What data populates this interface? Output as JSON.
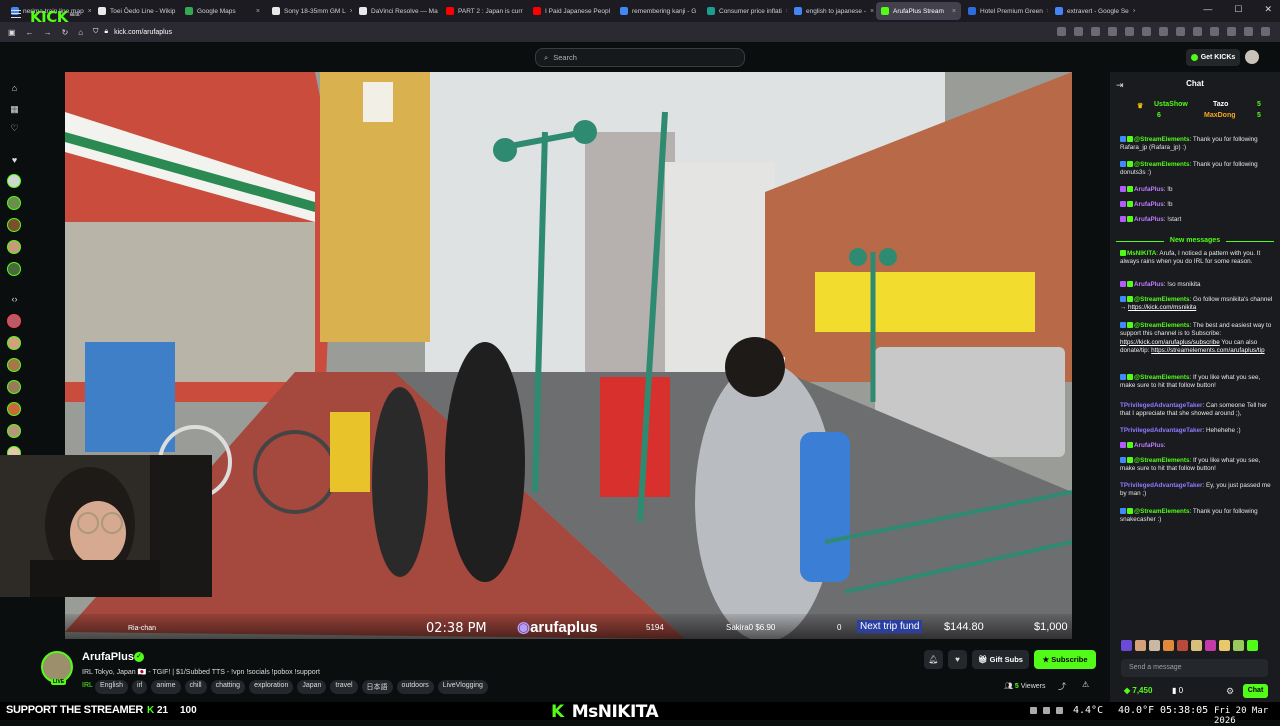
{
  "browser": {
    "tabs": [
      {
        "label": "nerima train line map",
        "color": "#4285f4"
      },
      {
        "label": "Toei Ōedo Line - Wikip",
        "color": "#e8e8e8"
      },
      {
        "label": "Google Maps",
        "color": "#34a853"
      },
      {
        "label": "Sony 18-35mm GM L",
        "color": "#e8e8e8"
      },
      {
        "label": "DaVinci Resolve — Ma",
        "color": "#e8e8e8"
      },
      {
        "label": "PART 2 : Japan is curr",
        "color": "#ff0000"
      },
      {
        "label": "I Paid Japanese Peopl",
        "color": "#ff0000"
      },
      {
        "label": "remembering kanji - G",
        "color": "#4285f4"
      },
      {
        "label": "Consumer price inflati",
        "color": "#1a9e8f"
      },
      {
        "label": "english to japanese -",
        "color": "#4285f4"
      },
      {
        "label": "ArufaPlus Stream",
        "color": "#53fc18",
        "active": true
      },
      {
        "label": "Hotel Premium Green",
        "color": "#2d6cdf"
      },
      {
        "label": "extravert - Google Se",
        "color": "#4285f4"
      }
    ],
    "url": "kick.com/arufaplus"
  },
  "kick": {
    "logo": "KICK",
    "logo_sup": "BETA",
    "search_placeholder": "Search",
    "get_kicks": "Get KICKs"
  },
  "overlay": {
    "time": "02:38 PM",
    "channel": "arufaplus",
    "count1": "5194",
    "sakira": "Sakira0 $6.90",
    "zero": "0",
    "trip": "Next trip fund",
    "amount": "$144.80",
    "goal": "$1,000",
    "ria": "Ria-chan"
  },
  "chat": {
    "title": "Chat",
    "gifters": [
      {
        "name": "UstaShow",
        "count": "6"
      },
      {
        "name": "Tazo",
        "count": "5"
      },
      {
        "name": "MaxDong",
        "count": "5"
      }
    ],
    "messages": [
      {
        "user": "@StreamElements",
        "text": ": Thank you for following Rafara_jp (Rafara_jp) :)"
      },
      {
        "user": "@StreamElements",
        "text": ": Thank you for following donuts3s :)"
      },
      {
        "user": "ArufaPlus",
        "text": ": !b"
      },
      {
        "user": "ArufaPlus",
        "text": ": !b"
      },
      {
        "user": "ArufaPlus",
        "text": ": !start"
      },
      {
        "user": "MsNIKITA",
        "text": ": Arufa, I noticed a pattern with you. It always rains when you do IRL for some reason."
      },
      {
        "user": "ArufaPlus",
        "text": ": !so msnikita"
      },
      {
        "user": "@StreamElements",
        "text": ": Go follow msnikita's channel → ",
        "link": "https://kick.com/msnikita"
      },
      {
        "user": "@StreamElements",
        "text": ": The best and easiest way to support this channel is to Subscribe: ",
        "link": "https://kick.com/arufaplus/subscribe",
        "text2": " You can also donate/tip: ",
        "link2": "https://streamelements.com/arufaplus/tip"
      },
      {
        "user": "@StreamElements",
        "text": ": If you like what you see, make sure to hit that follow button!"
      },
      {
        "user": "TPrivilegedAdvantageTaker",
        "text": ": Can someone Tell her that I appreciate that she showed around ;),"
      },
      {
        "user": "TPrivilegedAdvantageTaker",
        "text": ": Hehehehe ;)"
      },
      {
        "user": "ArufaPlus",
        "text": ":"
      },
      {
        "user": "@StreamElements",
        "text": ": If you like what you see, make sure to hit that follow button!"
      },
      {
        "user": "TPrivilegedAdvantageTaker",
        "text": ": Ey, you just passed me by man ;)"
      },
      {
        "user": "@StreamElements",
        "text": ": Thank you for following snakecasher :)"
      }
    ],
    "new_messages": "New messages",
    "input_placeholder": "Send a message",
    "kicks": "7,450",
    "zero": "0",
    "chat_button": "Chat"
  },
  "stream_info": {
    "channel_name": "ArufaPlus",
    "live": "LIVE",
    "title": "IRL Tokyo, Japan 🇯🇵 - TGIF! | $1/Subbed TTS - !vpn !socials !pobox !support",
    "category": "IRL",
    "tags": [
      "English",
      "irl",
      "anime",
      "chill",
      "chatting",
      "exploration",
      "Japan",
      "travel",
      "日本語",
      "outdoors",
      "LiveVlogging"
    ],
    "gift_subs": "Gift Subs",
    "subscribe": "Subscribe",
    "viewers": "5",
    "viewers_label": "Viewers"
  },
  "taskbar": {
    "support": "SUPPORT THE STREAMER",
    "kick": "K",
    "n1": "21",
    "n2": "100",
    "brand_k": "K",
    "brand": "MsNIKITA",
    "temp1": "4.4°C",
    "temp2": "40.0°F",
    "clock": "05:38:05",
    "date": "Fri 20 Mar 2026"
  }
}
